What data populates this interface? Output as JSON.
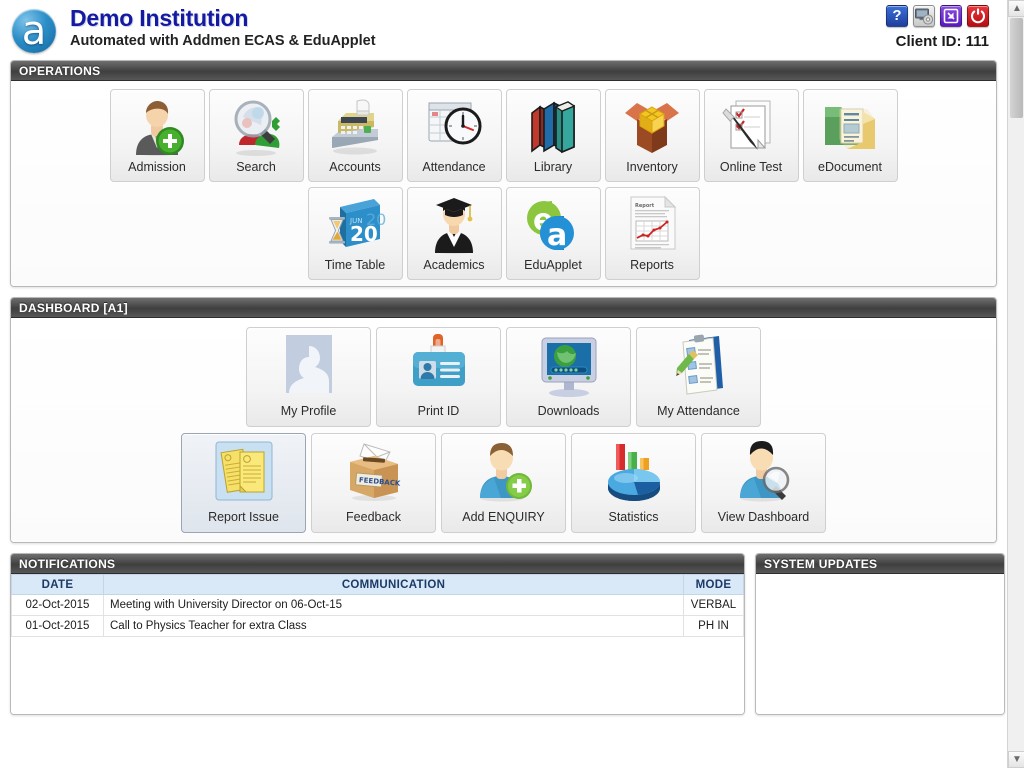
{
  "header": {
    "logo_glyph": "a",
    "institution": "Demo Institution",
    "subtitle": "Automated with Addmen ECAS & EduApplet",
    "client_id": "Client ID: 111",
    "icons": [
      {
        "name": "help-icon",
        "label": "?",
        "color": "#1f3f9e"
      },
      {
        "name": "settings-icon",
        "label": "",
        "color": "#c9c9c9"
      },
      {
        "name": "logout-icon",
        "label": "",
        "color": "#5a17c0"
      },
      {
        "name": "power-icon",
        "label": "",
        "color": "#b70d12"
      }
    ]
  },
  "operations": {
    "title": "OPERATIONS",
    "row1": [
      {
        "label": "Admission",
        "icon": "user-add-icon"
      },
      {
        "label": "Search",
        "icon": "magnifier-wrench-icon"
      },
      {
        "label": "Accounts",
        "icon": "cash-register-icon"
      },
      {
        "label": "Attendance",
        "icon": "calendar-clock-icon"
      },
      {
        "label": "Library",
        "icon": "books-icon"
      },
      {
        "label": "Inventory",
        "icon": "open-box-icon"
      },
      {
        "label": "Online Test",
        "icon": "checklist-pen-icon"
      },
      {
        "label": "eDocument",
        "icon": "folder-document-icon"
      }
    ],
    "row2": [
      {
        "label": "Time Table",
        "icon": "calendar-hourglass-icon"
      },
      {
        "label": "Academics",
        "icon": "graduate-icon"
      },
      {
        "label": "EduApplet",
        "icon": "ea-logo-icon"
      },
      {
        "label": "Reports",
        "icon": "report-chart-icon"
      }
    ]
  },
  "dashboard": {
    "title": "DASHBOARD [A1]",
    "row1": [
      {
        "label": "My Profile",
        "icon": "avatar-placeholder-icon"
      },
      {
        "label": "Print ID",
        "icon": "id-badge-icon"
      },
      {
        "label": "Downloads",
        "icon": "monitor-globe-icon"
      },
      {
        "label": "My Attendance",
        "icon": "clipboard-pencil-icon"
      }
    ],
    "row2": [
      {
        "label": "Report Issue",
        "icon": "documents-icon",
        "selected": true
      },
      {
        "label": "Feedback",
        "icon": "feedback-box-icon"
      },
      {
        "label": "Add ENQUIRY",
        "icon": "user-plus-icon"
      },
      {
        "label": "Statistics",
        "icon": "pie-bar-chart-icon"
      },
      {
        "label": "View Dashboard",
        "icon": "user-magnifier-icon"
      }
    ]
  },
  "notifications": {
    "title": "NOTIFICATIONS",
    "columns": [
      "DATE",
      "COMMUNICATION",
      "MODE"
    ],
    "rows": [
      {
        "date": "02-Oct-2015",
        "communication": "Meeting with University Director on 06-Oct-15",
        "mode": "VERBAL"
      },
      {
        "date": "01-Oct-2015",
        "communication": "Call to Physics Teacher for extra Class",
        "mode": "PH IN"
      }
    ]
  },
  "system_updates": {
    "title": "SYSTEM UPDATES",
    "items": []
  },
  "scrollbar": {
    "up_arrow": "▲",
    "down_arrow": "▼"
  },
  "colors": {
    "panel_header_dark": "#3f3f3f",
    "title_blue": "#151ba0",
    "table_header_bg": "#d9e9f7",
    "accent_blue": "#2d8fc9"
  }
}
